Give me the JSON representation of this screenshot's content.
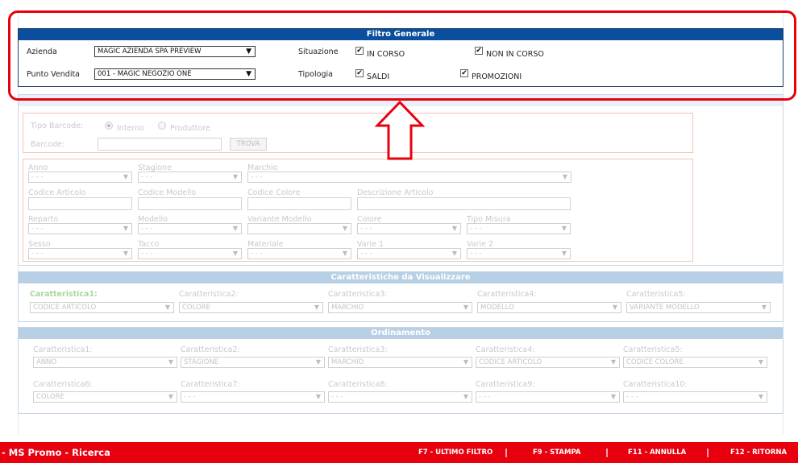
{
  "filtro_generale": {
    "title": "Filtro Generale",
    "azienda_label": "Azienda",
    "azienda_value": "MAGIC AZIENDA SPA PREVIEW",
    "punto_vendita_label": "Punto Vendita",
    "punto_vendita_value": "001 - MAGIC NEGOZIO ONE",
    "situazione_label": "Situazione",
    "in_corso_label": "IN CORSO",
    "in_corso_checked": true,
    "non_in_corso_label": "NON IN CORSO",
    "non_in_corso_checked": true,
    "tipologia_label": "Tipologia",
    "saldi_label": "SALDI",
    "saldi_checked": true,
    "promozioni_label": "PROMOZIONI",
    "promozioni_checked": true
  },
  "filtro_articoli": {
    "tipo_barcode_label": "Tipo Barcode:",
    "interno_label": "Interno",
    "produttore_label": "Produttore",
    "barcode_label": "Barcode:",
    "trova_label": "TROVA",
    "anno_label": "Anno",
    "stagione_label": "Stagione",
    "marchio_label": "Marchio",
    "codice_articolo_label": "Codice Articolo",
    "codice_modello_label": "Codice Modello",
    "codice_colore_label": "Codice Colore",
    "descrizione_articolo_label": "Descrizione Articolo",
    "reparto_label": "Reparto",
    "modello_label": "Modello",
    "variante_modello_label": "Variante Modello",
    "colore_label": "Colore",
    "tipo_misura_label": "Tipo Misura",
    "sesso_label": "Sesso",
    "tacco_label": "Tacco",
    "materiale_label": "Materiale",
    "varie1_label": "Varie 1",
    "varie2_label": "Varie 2",
    "empty_option": "- - -"
  },
  "caratteristiche": {
    "title": "Caratteristiche da Visualizzare",
    "items": [
      {
        "label": "Caratteristica1:",
        "value": "CODICE ARTICOLO"
      },
      {
        "label": "Caratteristica2:",
        "value": "COLORE"
      },
      {
        "label": "Caratteristica3:",
        "value": "MARCHIO"
      },
      {
        "label": "Caratteristica4:",
        "value": "MODELLO"
      },
      {
        "label": "Caratteristica5:",
        "value": "VARIANTE MODELLO"
      }
    ]
  },
  "ordinamento": {
    "title": "Ordinamento",
    "items": [
      {
        "label": "Caratteristica1:",
        "value": "ANNO"
      },
      {
        "label": "Caratteristica2:",
        "value": "STAGIONE"
      },
      {
        "label": "Caratteristica3:",
        "value": "MARCHIO"
      },
      {
        "label": "Caratteristica4:",
        "value": "CODICE ARTICOLO"
      },
      {
        "label": "Caratteristica5:",
        "value": "CODICE COLORE"
      },
      {
        "label": "Caratteristica6:",
        "value": "COLORE"
      },
      {
        "label": "Caratteristica7:",
        "value": "- - -"
      },
      {
        "label": "Caratteristica8:",
        "value": "- - -"
      },
      {
        "label": "Caratteristica9:",
        "value": "- - -"
      },
      {
        "label": "Caratteristica10:",
        "value": "- - -"
      }
    ]
  },
  "statusbar": {
    "title": "- MS Promo - Ricerca",
    "f7": "F7 - ULTIMO FILTRO",
    "f9": "F9 - STAMPA",
    "f11": "F11 - ANNULLA",
    "f12": "F12 - RITORNA",
    "separator": "|"
  },
  "colors": {
    "highlight_red": "#e8000f",
    "header_blue": "#0a4f9e",
    "panel_header_light": "#b8d0e6",
    "caratteristica1_green": "#a7d99a"
  }
}
